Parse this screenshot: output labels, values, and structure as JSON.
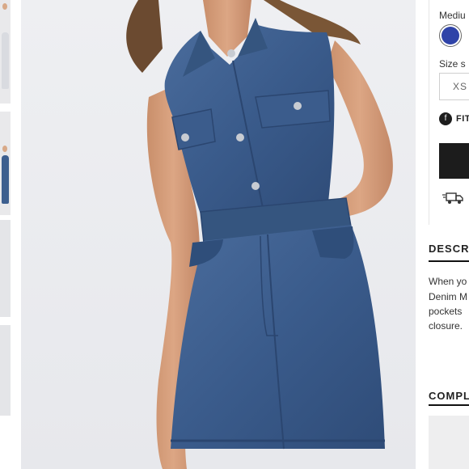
{
  "product": {
    "image_alt": "Model wearing a sleeveless denim mini dress"
  },
  "colors": {
    "swatch": "#2f43a8",
    "denim": "#3d5f8f"
  },
  "options": {
    "color_label": "Mediu",
    "size_label": "Size s",
    "size_value": "XS",
    "fit_label": "FIT"
  },
  "icons": {
    "fit": "info-icon",
    "shipping": "truck-icon"
  },
  "description": {
    "heading": "DESCR",
    "lines": [
      "When yo",
      "Denim M",
      "pockets",
      "closure."
    ]
  },
  "complete": {
    "heading": "COMPL"
  }
}
